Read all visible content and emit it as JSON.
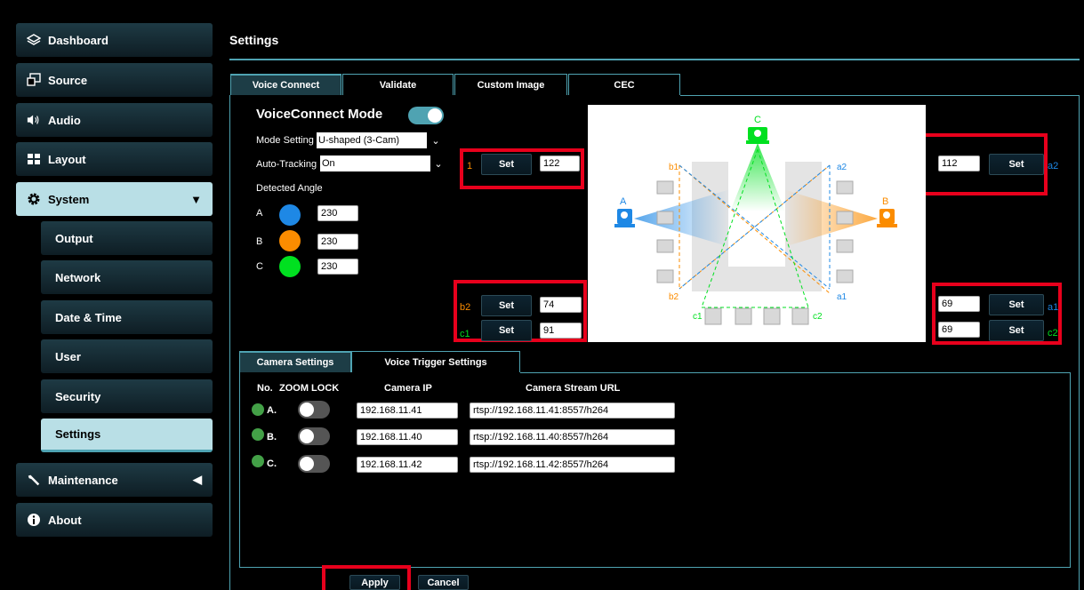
{
  "sidebar": {
    "dashboard": "Dashboard",
    "source": "Source",
    "audio": "Audio",
    "layout": "Layout",
    "system": "System",
    "output": "Output",
    "network": "Network",
    "datetime": "Date & Time",
    "user": "User",
    "security": "Security",
    "settings": "Settings",
    "maintenance": "Maintenance",
    "about": "About"
  },
  "page_title": "Settings",
  "tabs": [
    "Voice Connect",
    "Validate",
    "Custom Image",
    "CEC"
  ],
  "voice": {
    "mode_title": "VoiceConnect Mode",
    "mode_setting_label": "Mode Setting",
    "mode_setting_value": "U-shaped (3-Cam)",
    "auto_tracking_label": "Auto-Tracking",
    "auto_tracking_value": "On",
    "detected_angle_label": "Detected Angle",
    "angles": [
      {
        "label": "A",
        "value": "230",
        "color": "#1e88e5"
      },
      {
        "label": "B",
        "value": "230",
        "color": "#fb8c00"
      },
      {
        "label": "C",
        "value": "230",
        "color": "#00e020"
      }
    ]
  },
  "set_label": "Set",
  "positions": {
    "b1": {
      "label": "1",
      "value": "122"
    },
    "a2": {
      "label": "a2",
      "value": "112"
    },
    "b2": {
      "label": "b2",
      "value": "74"
    },
    "c1": {
      "label": "c1",
      "value": "91"
    },
    "a1": {
      "label": "a1",
      "value": "69"
    },
    "c2": {
      "label": "c2",
      "value": "69"
    }
  },
  "diagram": {
    "cam_a": "A",
    "cam_b": "B",
    "cam_c": "C",
    "b1": "b1",
    "a2": "a2",
    "b2": "b2",
    "a1": "a1",
    "c1": "c1",
    "c2": "c2"
  },
  "subtabs": [
    "Camera Settings",
    "Voice Trigger Settings"
  ],
  "camera_table": {
    "headers": {
      "no": "No.",
      "zoom_lock": "ZOOM LOCK",
      "ip": "Camera IP",
      "url": "Camera Stream URL"
    },
    "rows": [
      {
        "id": "A.",
        "ip": "192.168.11.41",
        "url": "rtsp://192.168.11.41:8557/h264"
      },
      {
        "id": "B.",
        "ip": "192.168.11.40",
        "url": "rtsp://192.168.11.40:8557/h264"
      },
      {
        "id": "C.",
        "ip": "192.168.11.42",
        "url": "rtsp://192.168.11.42:8557/h264"
      }
    ]
  },
  "footer": {
    "apply": "Apply",
    "cancel": "Cancel"
  }
}
